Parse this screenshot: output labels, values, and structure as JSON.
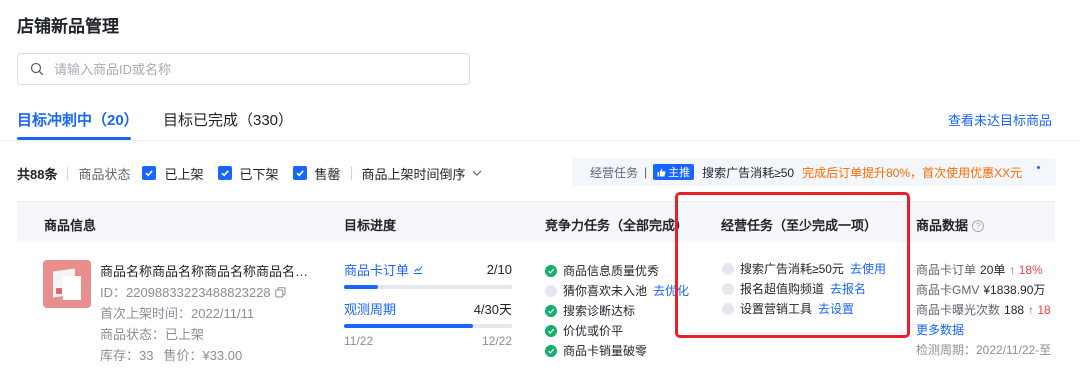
{
  "page": {
    "title": "店铺新品管理"
  },
  "search": {
    "placeholder": "请输入商品ID或名称",
    "value": ""
  },
  "tabs": [
    {
      "label": "目标冲刺中（20）",
      "active": true
    },
    {
      "label": "目标已完成（330）",
      "active": false
    }
  ],
  "unmet_link": "查看未达目标商品",
  "filters": {
    "total": "共88条",
    "state_label": "商品状态",
    "checkboxes": [
      {
        "label": "已上架",
        "checked": true
      },
      {
        "label": "已下架",
        "checked": true
      },
      {
        "label": "售罄",
        "checked": true
      }
    ],
    "sort": "商品上架时间倒序"
  },
  "banner": {
    "label": "经营任务",
    "sep": "|",
    "badge": "主推",
    "text": "搜索广告消耗≥50",
    "promo": "完成后订单提升80%，首次使用优惠XX元"
  },
  "table": {
    "headers": {
      "product": "商品信息",
      "progress": "目标进度",
      "competitive": "竞争力任务（全部完成）",
      "operation": "经营任务（至少完成一项）",
      "data": "商品数据"
    },
    "row": {
      "product": {
        "name": "商品名称商品名称商品名称商品名称商品...",
        "id": "ID：22098833223488823228",
        "first_listed": "首次上架时间：2022/11/11",
        "status": "商品状态：已上架",
        "stock": "库存：33",
        "price": "售价：¥33.00"
      },
      "progress": {
        "metric_label": "商品卡订单",
        "metric_value": "2/10",
        "metric_fraction": 0.2,
        "period_label": "观测周期",
        "period_value": "4/30天",
        "period_fraction": 0.7667,
        "start_date": "11/22",
        "end_date": "12/22"
      },
      "competitive_tasks": [
        {
          "label": "商品信息质量优秀",
          "done": true,
          "link": ""
        },
        {
          "label": "猜你喜欢未入池",
          "done": false,
          "link": "去优化"
        },
        {
          "label": "搜索诊断达标",
          "done": true,
          "link": ""
        },
        {
          "label": "价优或价平",
          "done": true,
          "link": ""
        },
        {
          "label": "商品卡销量破零",
          "done": true,
          "link": ""
        }
      ],
      "operation_tasks": [
        {
          "label": "搜索广告消耗≥50元",
          "done": false,
          "link": "去使用"
        },
        {
          "label": "报名超值购频道",
          "done": false,
          "link": "去报名"
        },
        {
          "label": "设置营销工具",
          "done": false,
          "link": "去设置"
        }
      ],
      "data": {
        "metrics": [
          {
            "label": "商品卡订单",
            "value": "20单",
            "trend": "↑ 18%"
          },
          {
            "label": "商品卡GMV",
            "value": "¥1838.90万",
            "trend": ""
          },
          {
            "label": "商品卡曝光次数",
            "value": "188",
            "trend": "↑ 18"
          }
        ],
        "more_link": "更多数据",
        "period": "检测周期：2022/11/22-至"
      }
    }
  },
  "colors": {
    "accent": "#1966ff",
    "success": "#12b06a",
    "warning": "#ff6a00",
    "danger": "#f53f3f",
    "highlight_box": "#e8202a"
  }
}
